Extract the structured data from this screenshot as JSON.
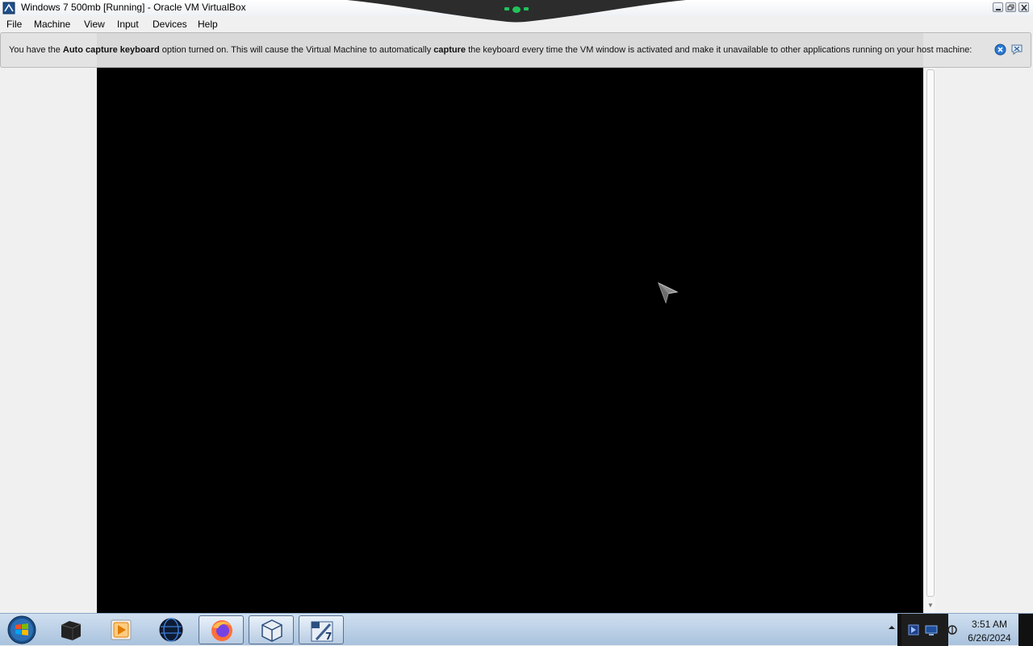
{
  "window": {
    "title": "Windows 7 500mb [Running] - Oracle VM VirtualBox"
  },
  "menu": {
    "file": "File",
    "machine": "Machine",
    "view": "View",
    "input": "Input",
    "devices": "Devices",
    "help": "Help"
  },
  "notice": {
    "part1": "You have the ",
    "bold1": "Auto capture keyboard",
    "part2": " option turned on. This will cause the Virtual Machine to automatically ",
    "bold2": "capture",
    "part3": " the keyboard every time the VM window is activated and make it unavailable to other applications running on your host machine:",
    "close_icon": "close-circle-icon",
    "dismiss_icon": "dismiss-message-icon"
  },
  "vm": {
    "screen_color": "#000000",
    "cursor_icon": "mouse-pointer-icon"
  },
  "taskbar": {
    "apps": [
      {
        "name": "start",
        "icon": "windows-orb-icon"
      },
      {
        "name": "terminal",
        "icon": "terminal-icon",
        "active": false
      },
      {
        "name": "media-player",
        "icon": "media-player-icon",
        "active": false
      },
      {
        "name": "network-globe",
        "icon": "globe-icon",
        "active": false
      },
      {
        "name": "firefox",
        "icon": "firefox-icon",
        "active": true
      },
      {
        "name": "virtualbox",
        "icon": "virtualbox-icon",
        "active": true
      },
      {
        "name": "windows-7-vm",
        "icon": "windows7-vm-icon",
        "active": true
      }
    ],
    "clock_time": "3:51 AM",
    "clock_date": "6/26/2024"
  },
  "colors": {
    "vm_background": "#000000",
    "taskbar_top": "#cfdff0",
    "taskbar_bottom": "#a9c2dd",
    "notice_background": "#e2e2e2",
    "indicator_green": "#22c35a"
  }
}
